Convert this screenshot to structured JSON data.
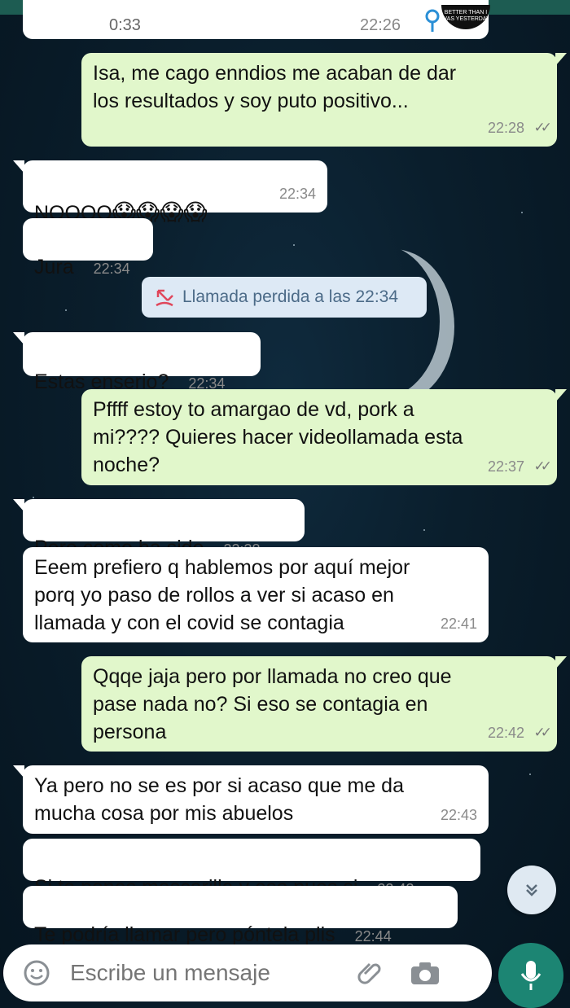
{
  "header": {
    "left_time": "0:33",
    "right_time": "22:26",
    "sticker_text": "BETTER THAN I WAS YESTERDAY"
  },
  "messages": [
    {
      "dir": "out",
      "text": "Isa, me cago enndios me acaban de dar\nlos resultados y soy puto positivo...",
      "time": "22:28",
      "ticks": "✓✓"
    },
    {
      "dir": "in",
      "text": "NOOOO",
      "emojis": "😱😱😱😱",
      "time": "22:34"
    },
    {
      "dir": "in",
      "text": "Jura",
      "time": "22:34"
    },
    {
      "dir": "in",
      "text": "Estas enserio?",
      "time": "22:34"
    },
    {
      "dir": "out",
      "text": "Pffff estoy to amargao de vd, pork a\nmi???? Quieres hacer videollamada esta\nnoche?",
      "time": "22:37",
      "ticks": "✓✓"
    },
    {
      "dir": "in",
      "text": "Pero como ha sido",
      "time": "22:38"
    },
    {
      "dir": "in",
      "text": "Eeem prefiero q hablemos por aquí mejor\nporq yo paso de rollos a ver si acaso en\nllamada y con el covid se contagia",
      "time": "22:41"
    },
    {
      "dir": "out",
      "text": "Qqqe jaja pero por llamada no creo que\npase nada no? Si eso se contagia en\npersona",
      "time": "22:42",
      "ticks": "✓✓"
    },
    {
      "dir": "in",
      "text": "Ya pero no se es por si acaso que me da\nmucha cosa por mis abuelos",
      "time": "22:43"
    },
    {
      "dir": "in",
      "text": "Si te pones mascarilla y eso pues si",
      "time": "22:43"
    },
    {
      "dir": "in",
      "text": "Te podría llamar pero póntela plis",
      "time": "22:44"
    }
  ],
  "system_message": {
    "icon": "missed-call-icon",
    "text": "Llamada perdida a las 22:34"
  },
  "composer": {
    "placeholder": "Escribe un mensaje",
    "icons": [
      "emoji-icon",
      "attach-icon",
      "camera-icon",
      "mic-icon"
    ]
  },
  "scroll_button": {
    "icon": "double-chevron-down-icon"
  },
  "colors": {
    "incoming": "#ffffff",
    "outgoing": "#e1f7cb",
    "system": "#dde9f5",
    "accent": "#1c8573"
  }
}
